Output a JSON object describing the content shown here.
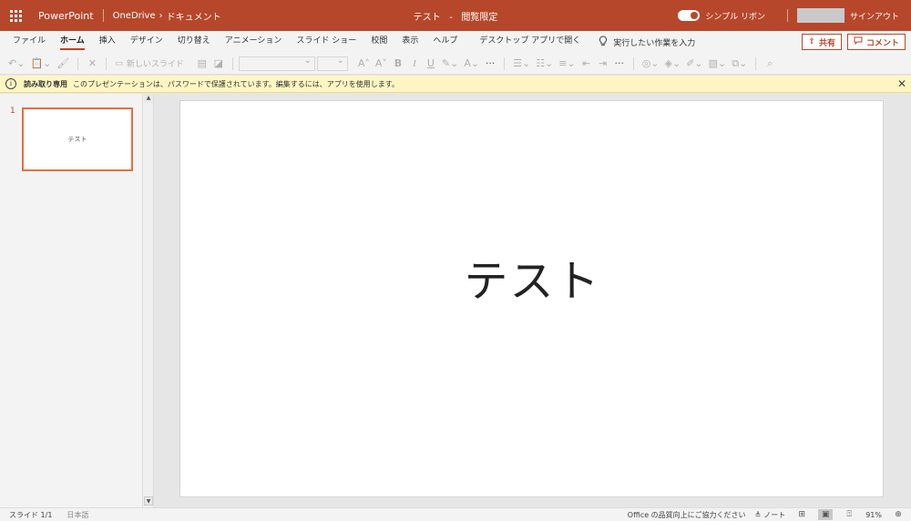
{
  "titlebar": {
    "app_name": "PowerPoint",
    "location": "OneDrive",
    "folder": "ドキュメント",
    "doc_title": "テスト",
    "title_separator": "-",
    "mode": "閲覧限定",
    "simple_ribbon_label": "シンプル リボン",
    "signout_label": "サインアウト",
    "brand_color": "#b7472a"
  },
  "menu": {
    "tabs": [
      "ファイル",
      "ホーム",
      "挿入",
      "デザイン",
      "切り替え",
      "アニメーション",
      "スライド ショー",
      "校閲",
      "表示",
      "ヘルプ",
      "デスクトップ アプリで開く"
    ],
    "active_tab": "ホーム",
    "tell_me": "実行したい作業を入力",
    "share_label": "共有",
    "comment_label": "コメント"
  },
  "toolbar": {
    "new_slide_label": "新しいスライド",
    "font_name": "",
    "font_size": ""
  },
  "infobar": {
    "title": "読み取り専用",
    "message": "このプレゼンテーションは、パスワードで保護されています。編集するには、アプリを使用します。",
    "background": "#fdf6c3"
  },
  "thumbnails": [
    {
      "number": "1",
      "title": "テスト"
    }
  ],
  "slide": {
    "title": "テスト"
  },
  "statusbar": {
    "slide_count": "スライド 1/1",
    "language": "日本語",
    "feedback": "Office の品質向上にご協力ください",
    "notes_label": "ノート",
    "zoom": "91%"
  }
}
